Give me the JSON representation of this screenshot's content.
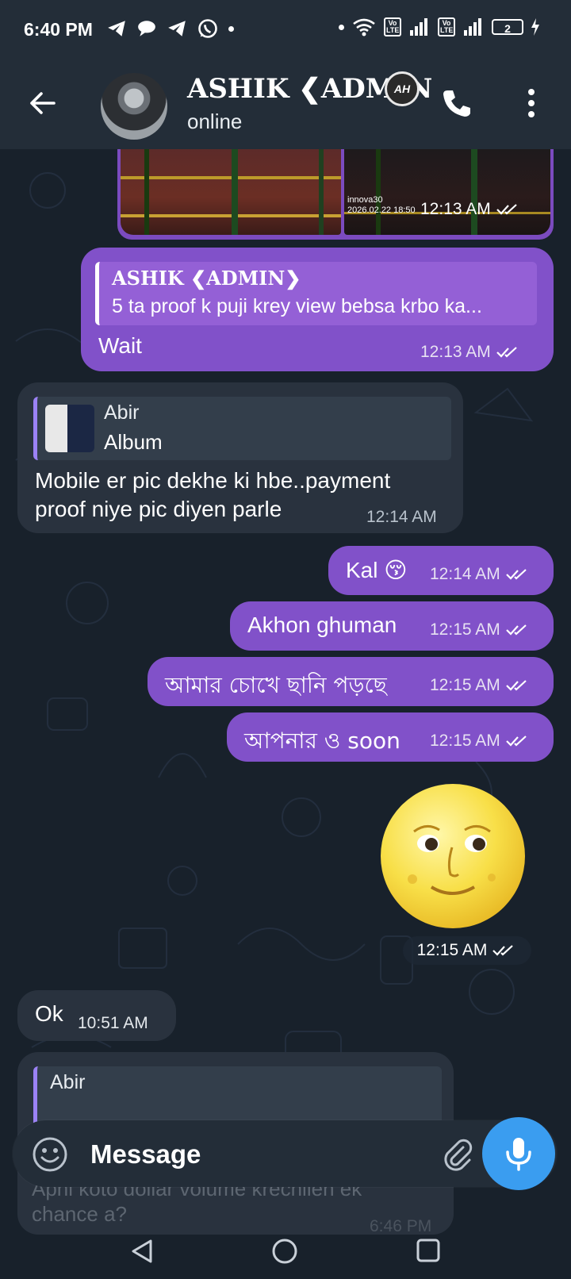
{
  "status_bar": {
    "time": "6:40 PM",
    "left_icons": [
      "telegram-icon",
      "chat-bubble-icon",
      "telegram-icon",
      "whatsapp-icon"
    ],
    "right_icons": [
      "wifi-icon",
      "volte-icon",
      "signal-icon",
      "volte-icon",
      "signal-icon",
      "battery-icon",
      "charging-icon"
    ],
    "volte_label": "Vo LTE",
    "battery_level": "2"
  },
  "header": {
    "title": "ASHIK ❮ADMIN",
    "badge_text": "AH",
    "status": "online"
  },
  "messages": {
    "album": {
      "caption_line1": "innova30",
      "caption_line2": "2026.02.22 18:50",
      "time": "12:13 AM"
    },
    "reply_wait": {
      "reply_author": "ASHIK ❮ADMIN❯",
      "reply_snippet": "5 ta proof k puji krey view bebsa krbo ka...",
      "text": "Wait",
      "time": "12:13 AM"
    },
    "abir_reply": {
      "reply_author": "Abir",
      "reply_snippet": "Album",
      "text_line1": "Mobile er pic dekhe ki hbe..payment",
      "text_line2": "proof niye pic diyen parle",
      "time": "12:14 AM"
    },
    "kal": {
      "text": "Kal 😚",
      "time": "12:14 AM"
    },
    "akhon": {
      "text": "Akhon ghuman",
      "time": "12:15 AM"
    },
    "bangla1": {
      "text": "আমার চোখে ছানি পড়ছে",
      "time": "12:15 AM"
    },
    "bangla2": {
      "text": "আপনার ও soon",
      "time": "12:15 AM"
    },
    "moon_sticker": {
      "time": "12:15 AM"
    },
    "ok": {
      "text": "Ok",
      "time": "10:51 AM"
    },
    "partial": {
      "reply_author": "Abir",
      "text_line1": "Apni koto dollar volume krechilen ek",
      "text_line2": "chance a?",
      "time": "6:46 PM"
    }
  },
  "input": {
    "placeholder": "Message"
  },
  "colors": {
    "outgoing_bubble": "#8151c9",
    "incoming_bubble": "#29323e",
    "header_bg": "#232d38",
    "chat_bg": "#18212b",
    "mic_button": "#3a9df0"
  }
}
